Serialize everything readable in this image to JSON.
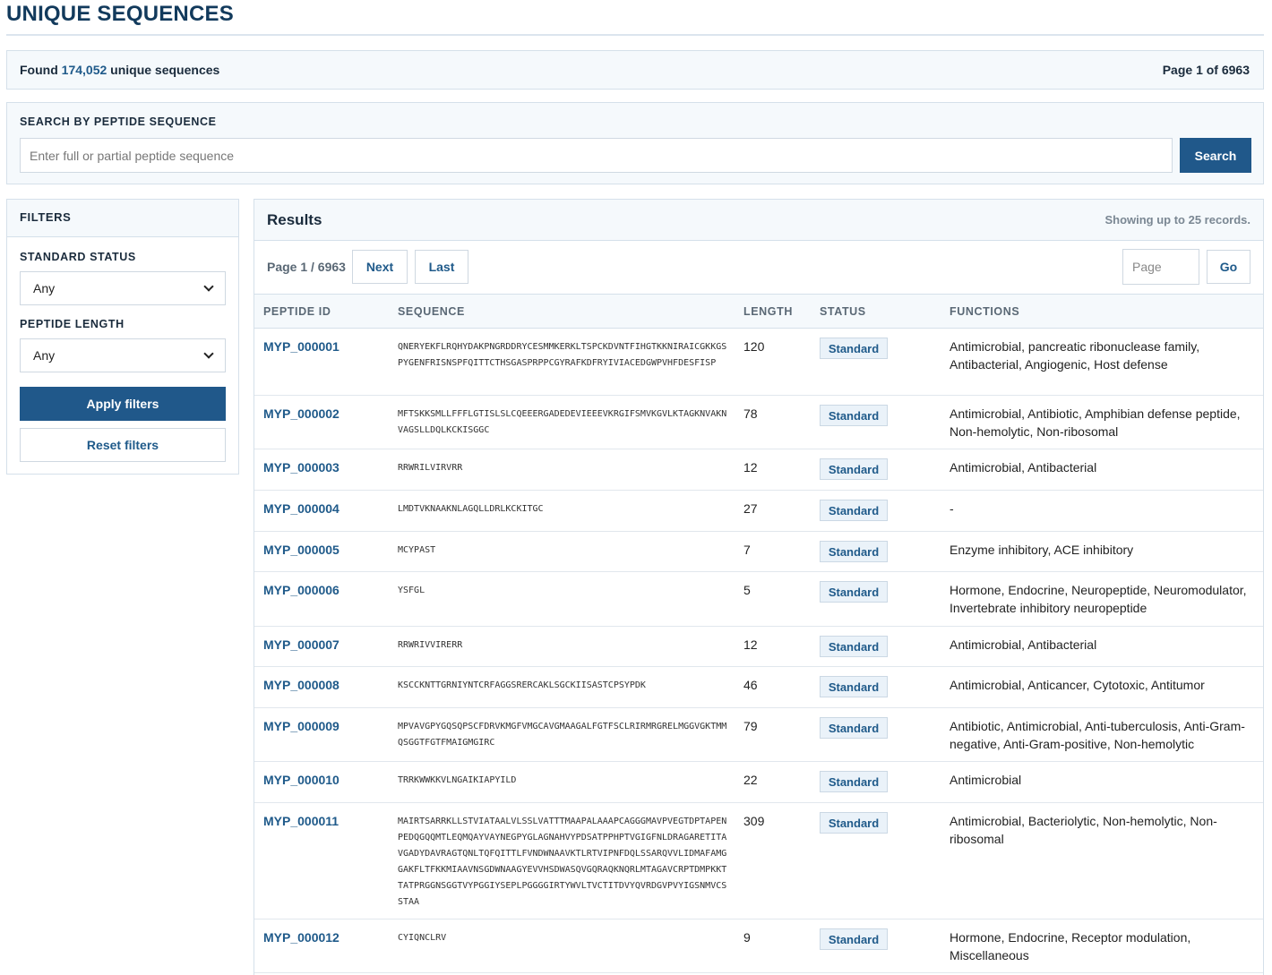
{
  "page": {
    "title": "UNIQUE SEQUENCES"
  },
  "summary": {
    "found_prefix": "Found",
    "count": "174,052",
    "found_suffix": "unique sequences",
    "page_label": "Page 1 of 6963"
  },
  "search": {
    "label": "SEARCH BY PEPTIDE SEQUENCE",
    "placeholder": "Enter full or partial peptide sequence",
    "value": "",
    "button": "Search"
  },
  "filters": {
    "title": "FILTERS",
    "standard_status": {
      "label": "STANDARD STATUS",
      "value": "Any"
    },
    "peptide_length": {
      "label": "PEPTIDE LENGTH",
      "value": "Any"
    },
    "apply": "Apply filters",
    "reset": "Reset filters"
  },
  "results": {
    "title": "Results",
    "note": "Showing up to 25 records.",
    "pager": {
      "info": "Page 1 / 6963",
      "next": "Next",
      "last": "Last",
      "page_placeholder": "Page",
      "go": "Go"
    },
    "columns": {
      "id": "PEPTIDE ID",
      "sequence": "SEQUENCE",
      "length": "LENGTH",
      "status": "STATUS",
      "functions": "FUNCTIONS"
    },
    "rows": [
      {
        "id": "MYP_000001",
        "sequence": "QNERYEKFLRQHYDAKPNGRDDRYCESMMKERKLTSPCKDVNTFIHGTKKNIRAICGKKGSPYGENFRISNSPFQITTCTHSGASPRPPCGYRAFKDFRYIVIACEDGWPVHFDESFISP",
        "length": "120",
        "status": "Standard",
        "functions": "Antimicrobial, pancreatic ribonuclease family, Antibacterial, Angiogenic, Host defense"
      },
      {
        "id": "MYP_000002",
        "sequence": "MFTSKKSMLLFFFLGTISLSLCQEEERGADEDEVIEEEVKRGIFSMVKGVLKTAGKNVAKNVAGSLLDQLKCKISGGC",
        "length": "78",
        "status": "Standard",
        "functions": "Antimicrobial, Antibiotic, Amphibian defense peptide, Non-hemolytic, Non-ribosomal"
      },
      {
        "id": "MYP_000003",
        "sequence": "RRWRILVIRVRR",
        "length": "12",
        "status": "Standard",
        "functions": "Antimicrobial, Antibacterial"
      },
      {
        "id": "MYP_000004",
        "sequence": "LMDTVKNAAKNLAGQLLDRLKCKITGC",
        "length": "27",
        "status": "Standard",
        "functions": "-"
      },
      {
        "id": "MYP_000005",
        "sequence": "MCYPAST",
        "length": "7",
        "status": "Standard",
        "functions": "Enzyme inhibitory, ACE inhibitory"
      },
      {
        "id": "MYP_000006",
        "sequence": "YSFGL",
        "length": "5",
        "status": "Standard",
        "functions": "Hormone, Endocrine, Neuropeptide, Neuromodulator, Invertebrate inhibitory neuropeptide"
      },
      {
        "id": "MYP_000007",
        "sequence": "RRWRIVVIRERR",
        "length": "12",
        "status": "Standard",
        "functions": "Antimicrobial, Antibacterial"
      },
      {
        "id": "MYP_000008",
        "sequence": "KSCCKNTTGRNIYNTCRFAGGSRERCAKLSGCKIISASTCPSYPDK",
        "length": "46",
        "status": "Standard",
        "functions": "Antimicrobial, Anticancer, Cytotoxic, Antitumor"
      },
      {
        "id": "MYP_000009",
        "sequence": "MPVAVGPYGQSQPSCFDRVKMGFVMGCAVGMAAGALFGTFSCLRIRMRGRELMGGVGKTMMQSGGTFGTFMAIGMGIRC",
        "length": "79",
        "status": "Standard",
        "functions": "Antibiotic, Antimicrobial, Anti-tuberculosis, Anti-Gram-negative, Anti-Gram-positive, Non-hemolytic"
      },
      {
        "id": "MYP_000010",
        "sequence": "TRRKWWKKVLNGAIKIAPYILD",
        "length": "22",
        "status": "Standard",
        "functions": "Antimicrobial"
      },
      {
        "id": "MYP_000011",
        "sequence": "MAIRTSARRKLLSTVIATAALVLSSLVATTTMAAPALAAAPCAGGGMAVPVEGTDPTAPENPEDQGQQMTLEQMQAYVAYNEGPYGLAGNAHVYPDSATPPHPTVGIGFNLDRAGARETITAVGADYDAVRAGTQNLTQFQITTLFVNDWNAAVKTLRTVIPNFDQLSSARQVVLIDMAFAMGGAKFLTFKKMIAAVNSGDWNAAGYEVVHSDWASQVGQRAQKNQRLMTAGAVCRPTDMPKKTTATPRGGNSGGTVYPGGIYSEPLPGGGGIRTYWVLTVCTITDVYQVRDGVPVYIGSNMVCSSTAA",
        "length": "309",
        "status": "Standard",
        "functions": "Antimicrobial, Bacteriolytic, Non-hemolytic, Non-ribosomal"
      },
      {
        "id": "MYP_000012",
        "sequence": "CYIQNCLRV",
        "length": "9",
        "status": "Standard",
        "functions": "Hormone, Endocrine, Receptor modulation, Miscellaneous"
      }
    ]
  }
}
